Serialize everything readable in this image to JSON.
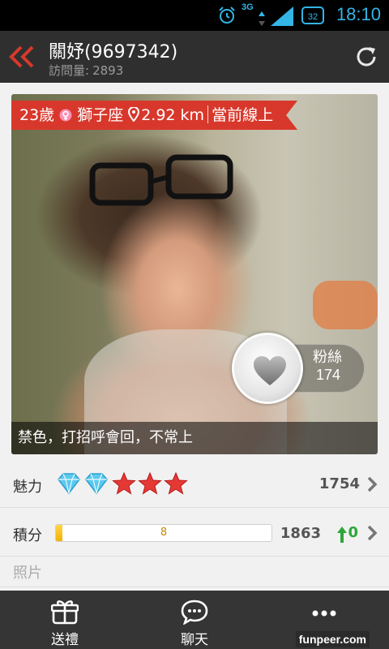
{
  "status_bar": {
    "network": "3G",
    "battery": "32",
    "time": "18:10"
  },
  "header": {
    "title": "關妤(9697342)",
    "visits_label": "訪問量:",
    "visits_value": "2893"
  },
  "profile_card": {
    "age": "23歲",
    "zodiac": "獅子座",
    "distance": "2.92 km",
    "online_status": "當前線上",
    "fans_label": "粉絲",
    "fans_count": "174",
    "caption": "禁色，打招呼會回，不常上"
  },
  "charm": {
    "label": "魅力",
    "diamonds": 2,
    "stars": 3,
    "value": "1754"
  },
  "points": {
    "label": "積分",
    "progress_value": "8",
    "value": "1863",
    "rise": "0"
  },
  "photos": {
    "label": "照片"
  },
  "tabbar": {
    "gift_label": "送禮",
    "chat_label": "聊天",
    "more_label": "更多"
  },
  "watermark": "funpeer.com",
  "colors": {
    "accent_red": "#d8382c",
    "status_blue": "#33b5e5",
    "rise_green": "#2ea63a",
    "progress_yellow": "#f2b200"
  }
}
